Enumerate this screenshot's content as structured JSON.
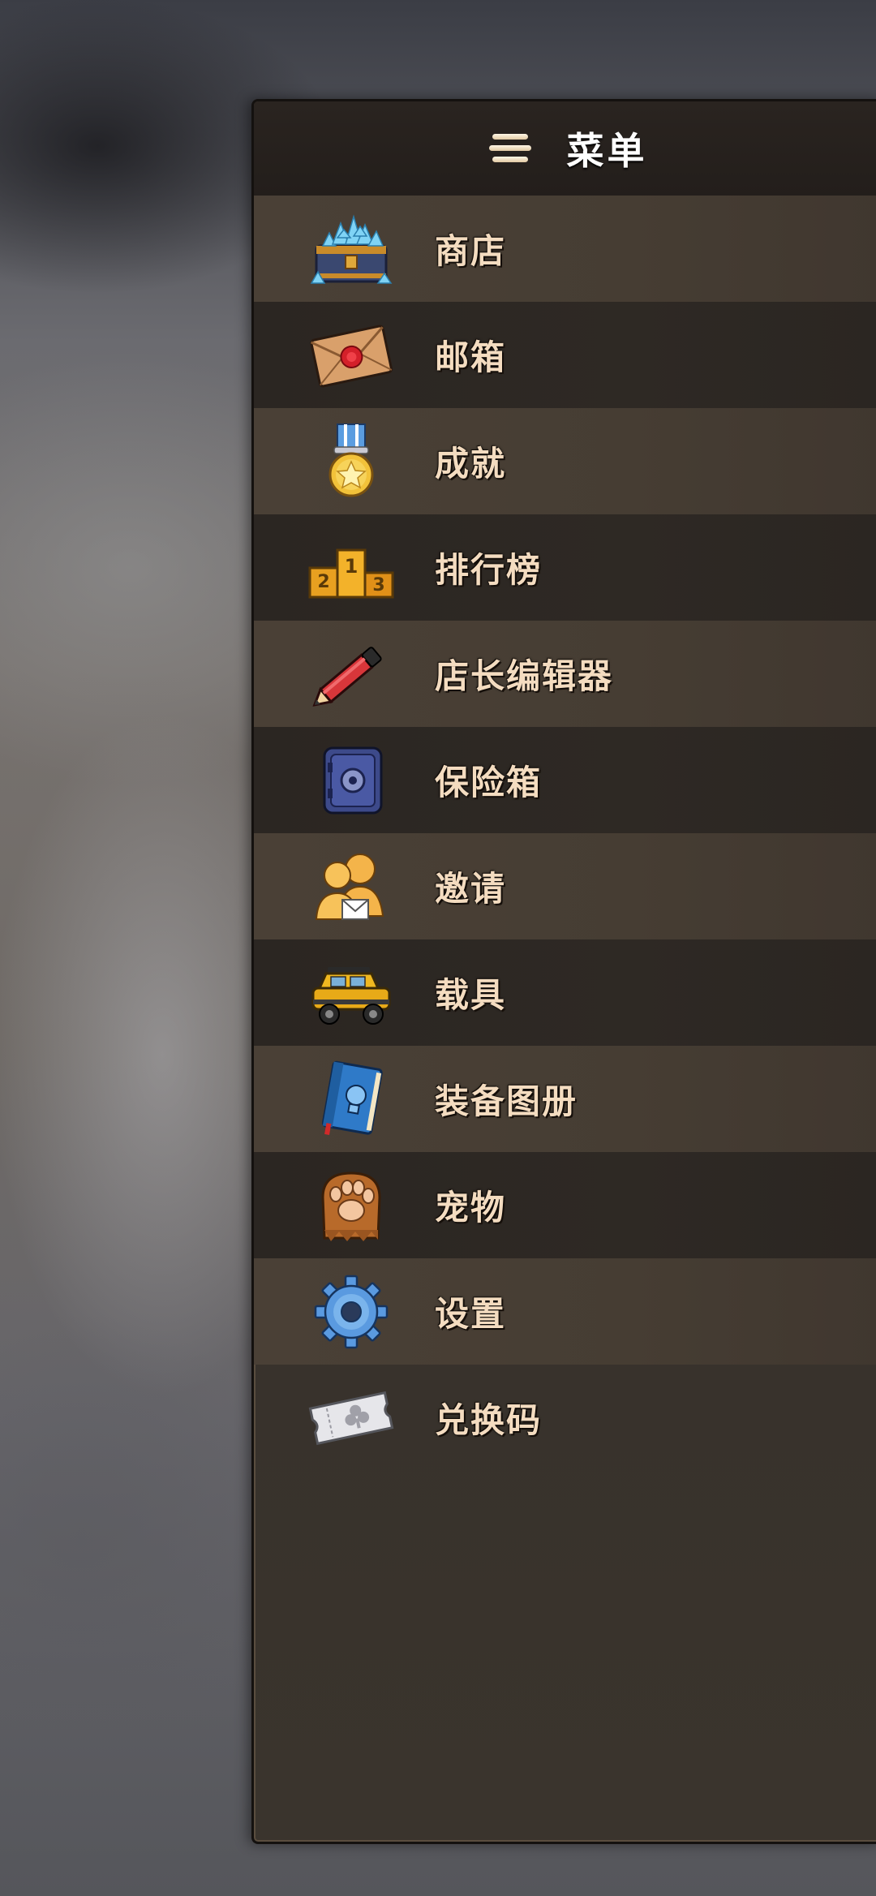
{
  "header": {
    "title": "菜单",
    "icon": "hamburger-icon"
  },
  "menu": {
    "items": [
      {
        "label": "商店",
        "icon": "gem-chest-icon"
      },
      {
        "label": "邮箱",
        "icon": "sealed-letter-icon"
      },
      {
        "label": "成就",
        "icon": "medal-icon"
      },
      {
        "label": "排行榜",
        "icon": "podium-icon"
      },
      {
        "label": "店长编辑器",
        "icon": "pencil-icon"
      },
      {
        "label": "保险箱",
        "icon": "safe-icon"
      },
      {
        "label": "邀请",
        "icon": "invite-friends-icon"
      },
      {
        "label": "载具",
        "icon": "jeep-icon"
      },
      {
        "label": "装备图册",
        "icon": "equipment-book-icon"
      },
      {
        "label": "宠物",
        "icon": "paw-icon"
      },
      {
        "label": "设置",
        "icon": "gear-icon"
      },
      {
        "label": "兑换码",
        "icon": "ticket-icon"
      }
    ]
  }
}
